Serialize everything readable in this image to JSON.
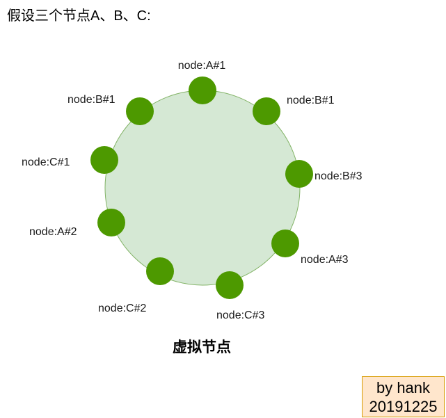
{
  "heading": "假设三个节点A、B、C:",
  "ring": {
    "fill": "#d5e8d4",
    "stroke": "#82b366"
  },
  "node_color": "#4d9900",
  "nodes": [
    {
      "id": "node-a1",
      "label": "node:A#1"
    },
    {
      "id": "node-b1-right",
      "label": "node:B#1"
    },
    {
      "id": "node-b3",
      "label": "node:B#3"
    },
    {
      "id": "node-a3",
      "label": "node:A#3"
    },
    {
      "id": "node-c3",
      "label": "node:C#3"
    },
    {
      "id": "node-c2",
      "label": "node:C#2"
    },
    {
      "id": "node-a2",
      "label": "node:A#2"
    },
    {
      "id": "node-c1",
      "label": "node:C#1"
    },
    {
      "id": "node-b1-left",
      "label": "node:B#1"
    }
  ],
  "caption": "虚拟节点",
  "signature": {
    "line1": "by hank",
    "line2": "20191225",
    "fill": "#ffe6cc",
    "stroke": "#d79b00"
  }
}
